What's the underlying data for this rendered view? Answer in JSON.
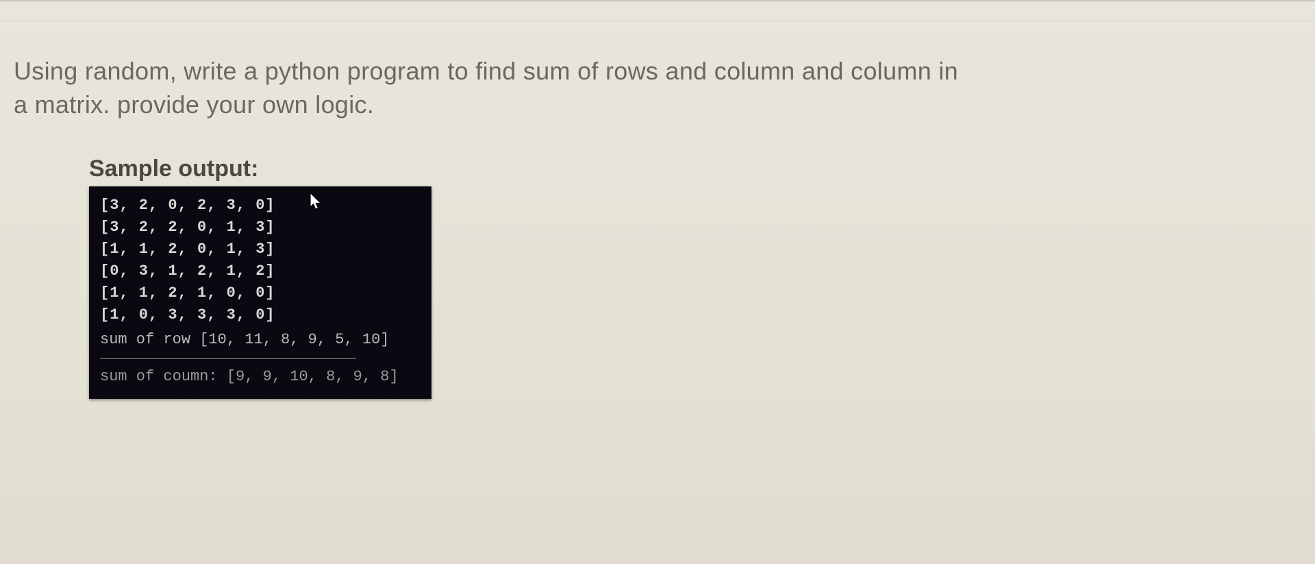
{
  "question": {
    "line1": "Using random, write a python program to find sum of rows and column and column in",
    "line2": "a matrix. provide your own logic."
  },
  "sample_label": "Sample output:",
  "console": {
    "rows": [
      "[3, 2, 0, 2, 3, 0]",
      "[3, 2, 2, 0, 1, 3]",
      "[1, 1, 2, 0, 1, 3]",
      "[0, 3, 1, 2, 1, 2]",
      "[1, 1, 2, 1, 0, 0]",
      "[1, 0, 3, 3, 3, 0]"
    ],
    "row_sum_label": "sum of row",
    "row_sum_values": "[10, 11, 8, 9, 5, 10]",
    "col_sum_label": "sum of coumn:",
    "col_sum_values": "[9, 9, 10, 8, 9, 8]"
  },
  "chart_data": {
    "type": "table",
    "matrix": [
      [
        3,
        2,
        0,
        2,
        3,
        0
      ],
      [
        3,
        2,
        2,
        0,
        1,
        3
      ],
      [
        1,
        1,
        2,
        0,
        1,
        3
      ],
      [
        0,
        3,
        1,
        2,
        1,
        2
      ],
      [
        1,
        1,
        2,
        1,
        0,
        0
      ],
      [
        1,
        0,
        3,
        3,
        3,
        0
      ]
    ],
    "row_sums": [
      10,
      11,
      8,
      9,
      5,
      10
    ],
    "column_sums": [
      9,
      9,
      10,
      8,
      9,
      8
    ]
  }
}
